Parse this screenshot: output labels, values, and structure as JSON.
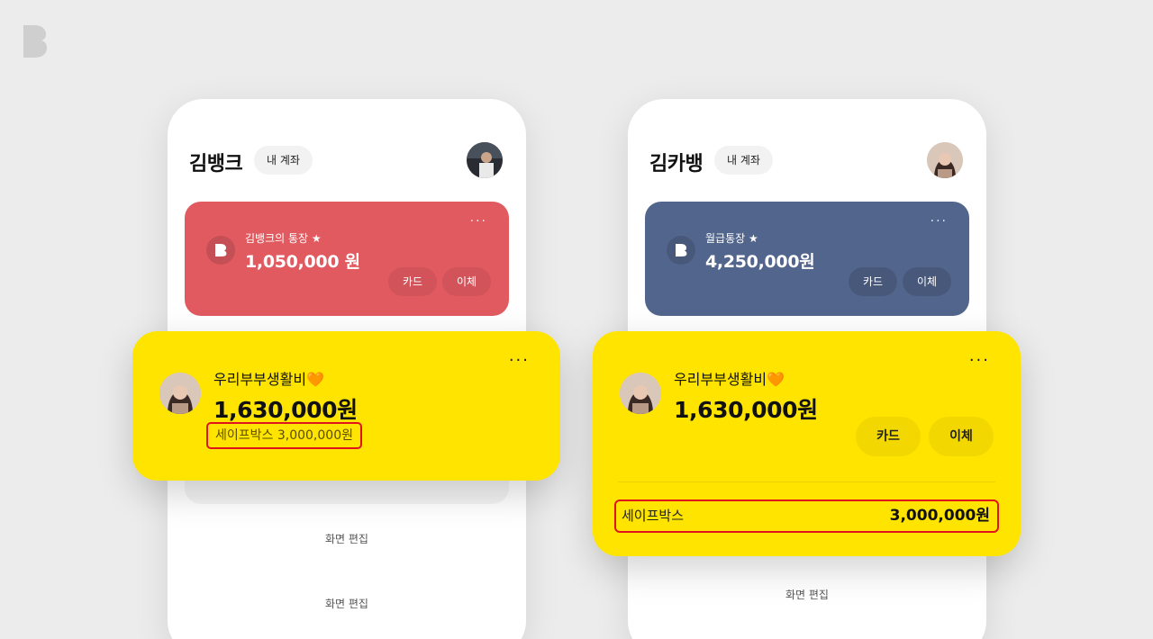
{
  "left_phone": {
    "user_name": "김뱅크",
    "my_account_label": "내 계좌",
    "account_card": {
      "title": "김뱅크의 통장 ★",
      "balance": "1,050,000 원",
      "card_button": "카드",
      "transfer_button": "이체",
      "more": "···",
      "color": "#e05a60"
    },
    "shared_card": {
      "title": "우리부부생활비🧡",
      "balance": "1,630,000원",
      "safebox": "세이프박스 3,000,000원",
      "more": "···"
    },
    "edit_label_1": "화면 편집",
    "edit_label_2": "화면 편집"
  },
  "right_phone": {
    "user_name": "김카뱅",
    "my_account_label": "내 계좌",
    "account_card": {
      "title": "월급통장 ★",
      "balance": "4,250,000원",
      "card_button": "카드",
      "transfer_button": "이체",
      "more": "···",
      "color": "#52658c"
    },
    "shared_card": {
      "title": "우리부부생활비🧡",
      "balance": "1,630,000원",
      "card_button": "카드",
      "transfer_button": "이체",
      "more": "···",
      "safebox_label": "세이프박스",
      "safebox_amount": "3,000,000원"
    },
    "edit_label": "화면 편집"
  },
  "accent_yellow": "#ffe400",
  "highlight_red": "#e0141e"
}
